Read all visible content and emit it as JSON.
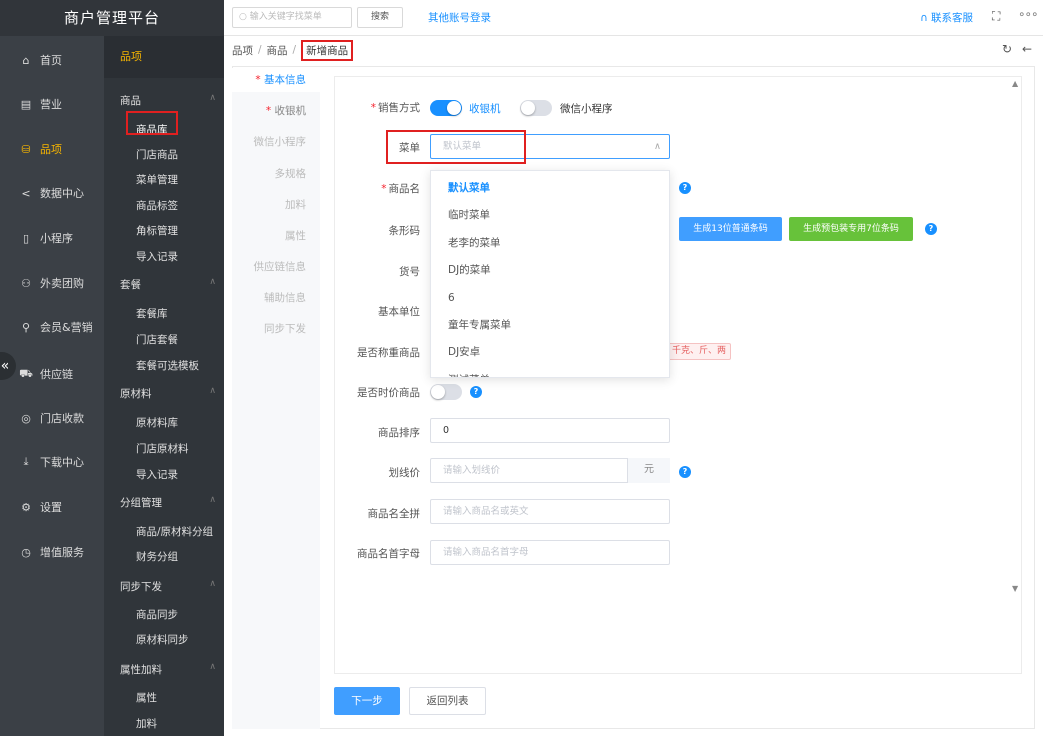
{
  "app": {
    "title": "商户管理平台"
  },
  "primary_nav": [
    {
      "label": "首页",
      "icon": "home-icon"
    },
    {
      "label": "营业",
      "icon": "calendar-icon"
    },
    {
      "label": "品项",
      "icon": "bag-icon",
      "active": true
    },
    {
      "label": "数据中心",
      "icon": "share-icon"
    },
    {
      "label": "小程序",
      "icon": "phone-icon"
    },
    {
      "label": "外卖团购",
      "icon": "group-icon"
    },
    {
      "label": "会员&营销",
      "icon": "user-icon"
    },
    {
      "label": "供应链",
      "icon": "truck-icon"
    },
    {
      "label": "门店收款",
      "icon": "coin-icon"
    },
    {
      "label": "下载中心",
      "icon": "download-icon"
    },
    {
      "label": "设置",
      "icon": "gear-icon"
    },
    {
      "label": "增值服务",
      "icon": "clock-icon"
    }
  ],
  "secondary_nav": {
    "title": "品项",
    "groups": [
      {
        "label": "商品",
        "items": [
          "商品库",
          "门店商品",
          "菜单管理",
          "商品标签",
          "角标管理",
          "导入记录"
        ]
      },
      {
        "label": "套餐",
        "items": [
          "套餐库",
          "门店套餐",
          "套餐可选模板"
        ]
      },
      {
        "label": "原材料",
        "items": [
          "原材料库",
          "门店原材料",
          "导入记录"
        ]
      },
      {
        "label": "分组管理",
        "items": [
          "商品/原材料分组",
          "财务分组"
        ]
      },
      {
        "label": "同步下发",
        "items": [
          "商品同步",
          "原材料同步"
        ]
      },
      {
        "label": "属性加料",
        "items": [
          "属性",
          "加料"
        ]
      }
    ]
  },
  "topbar": {
    "search_placeholder": "输入关键字找菜单",
    "search_button": "搜索",
    "other_login": "其他账号登录",
    "contact": "联系客服"
  },
  "breadcrumb": [
    "品项",
    "商品",
    "新增商品"
  ],
  "steps": [
    {
      "label": "基本信息",
      "required": true
    },
    {
      "label": "收银机",
      "required": true
    },
    {
      "label": "微信小程序"
    },
    {
      "label": "多规格"
    },
    {
      "label": "加料"
    },
    {
      "label": "属性"
    },
    {
      "label": "供应链信息"
    },
    {
      "label": "辅助信息"
    },
    {
      "label": "同步下发"
    }
  ],
  "form": {
    "sale_method_label": "销售方式",
    "sale_option_1": "收银机",
    "sale_option_2": "微信小程序",
    "menu_label": "菜单",
    "menu_placeholder": "默认菜单",
    "name_label": "商品名",
    "barcode_label": "条形码",
    "barcode_btn_13": "生成13位普通条码",
    "barcode_btn_7": "生成预包装专用7位条码",
    "sku_label": "货号",
    "unit_label": "基本单位",
    "weigh_label": "是否称重商品",
    "weigh_units": "千克、斤、两",
    "seasonal_label": "是否时价商品",
    "sort_label": "商品排序",
    "sort_value": "0",
    "strike_label": "划线价",
    "strike_placeholder": "请输入划线价",
    "strike_suffix": "元",
    "fullpinyin_label": "商品名全拼",
    "fullpinyin_placeholder": "请输入商品名或英文",
    "initials_label": "商品名首字母",
    "initials_placeholder": "请输入商品名首字母"
  },
  "menu_dropdown": [
    "默认菜单",
    "临时菜单",
    "老李的菜单",
    "DJ的菜单",
    "6",
    "童年专属菜单",
    "DJ安卓",
    "测试菜单"
  ],
  "actions": {
    "next": "下一步",
    "return": "返回列表"
  },
  "colors": {
    "accent": "#1890ff",
    "highlight": "#e02020",
    "nav_active": "#f7b500",
    "green": "#67c23a"
  }
}
